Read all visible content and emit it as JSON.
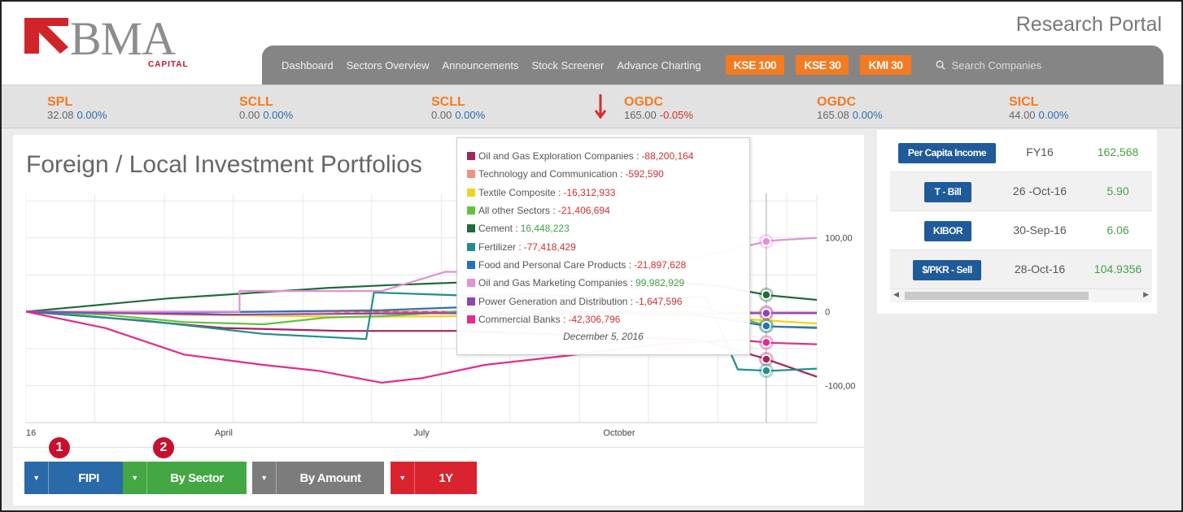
{
  "header": {
    "logo_text": "BMA",
    "logo_sub": "CAPITAL",
    "portal_title": "Research Portal",
    "nav": [
      "Dashboard",
      "Sectors Overview",
      "Announcements",
      "Stock Screener",
      "Advance Charting"
    ],
    "index_buttons": [
      "KSE 100",
      "KSE 30",
      "KMI 30"
    ],
    "search_placeholder": "Search Companies"
  },
  "ticker": [
    {
      "symbol": "SPL",
      "price": "32.08",
      "change": "0.00%"
    },
    {
      "symbol": "SCLL",
      "price": "0.00",
      "change": "0.00%"
    },
    {
      "symbol": "SCLL",
      "price": "0.00",
      "change": "0.00%"
    },
    {
      "symbol": "OGDC",
      "price": "165.00",
      "change": "-0.05%"
    },
    {
      "symbol": "OGDC",
      "price": "165.08",
      "change": "0.00%"
    },
    {
      "symbol": "SICL",
      "price": "44.00",
      "change": "0.00%"
    }
  ],
  "chart_panel": {
    "title": "Foreign / Local Investment Portfolios",
    "controls": [
      {
        "label": "FIPI",
        "color": "#2a6aa8"
      },
      {
        "label": "By Sector",
        "color": "#43a843"
      },
      {
        "label": "By Amount",
        "color": "#7c7c7c"
      },
      {
        "label": "1Y",
        "color": "#d9232e"
      }
    ],
    "step_badges": [
      "1",
      "2"
    ]
  },
  "tooltip": {
    "rows": [
      {
        "name": "Oil and Gas Exploration Companies",
        "value": "-88,200,164",
        "color": "#a5245d"
      },
      {
        "name": "Technology and Communication",
        "value": "-592,590",
        "color": "#f5907a"
      },
      {
        "name": "Textile Composite",
        "value": "-16,312,933",
        "color": "#f2d21d"
      },
      {
        "name": "All other Sectors",
        "value": "-21,406,694",
        "color": "#63c23c"
      },
      {
        "name": "Cement",
        "value": "16,448,223",
        "color": "#1f6b3a"
      },
      {
        "name": "Fertilizer",
        "value": "-77,418,429",
        "color": "#208f8a"
      },
      {
        "name": "Food and Personal Care Products",
        "value": "-21,897,628",
        "color": "#2a72b8"
      },
      {
        "name": "Oil and Gas Marketing Companies",
        "value": "99,982,929",
        "color": "#e191d6"
      },
      {
        "name": "Power Generation and Distribution",
        "value": "-1,647,596",
        "color": "#8a47b4"
      },
      {
        "name": "Commercial Banks",
        "value": "-42,306,796",
        "color": "#e42b8e"
      }
    ],
    "date": "December 5, 2016"
  },
  "chart_data": {
    "type": "line",
    "x_tick_labels": [
      "16",
      "April",
      "July",
      "October"
    ],
    "y_tick_labels": [
      "100,00",
      "0",
      "-100,00"
    ],
    "series": [
      {
        "name": "Oil and Gas Exploration Companies",
        "color": "#a5245d",
        "points": [
          [
            0,
            0
          ],
          [
            0.1,
            -8
          ],
          [
            0.25,
            -22
          ],
          [
            0.4,
            -26
          ],
          [
            0.55,
            -26
          ],
          [
            0.7,
            -32
          ],
          [
            0.85,
            -38
          ],
          [
            0.93,
            -62
          ],
          [
            1,
            -88
          ]
        ]
      },
      {
        "name": "Technology and Communication",
        "color": "#f5907a",
        "points": [
          [
            0,
            0
          ],
          [
            0.2,
            0
          ],
          [
            0.4,
            0
          ],
          [
            0.6,
            0
          ],
          [
            0.8,
            0
          ],
          [
            0.94,
            -1
          ],
          [
            1,
            -1
          ]
        ]
      },
      {
        "name": "Textile Composite",
        "color": "#f2d21d",
        "points": [
          [
            0,
            0
          ],
          [
            0.2,
            -4
          ],
          [
            0.4,
            -7
          ],
          [
            0.55,
            -6
          ],
          [
            0.7,
            -4
          ],
          [
            0.85,
            -6
          ],
          [
            0.94,
            -12
          ],
          [
            1,
            -16
          ]
        ]
      },
      {
        "name": "All other Sectors",
        "color": "#63c23c",
        "points": [
          [
            0,
            0
          ],
          [
            0.1,
            -4
          ],
          [
            0.2,
            -14
          ],
          [
            0.3,
            -17
          ],
          [
            0.38,
            -8
          ],
          [
            0.45,
            -6
          ],
          [
            0.6,
            4
          ],
          [
            0.75,
            8
          ],
          [
            0.85,
            8
          ],
          [
            0.94,
            -20
          ],
          [
            1,
            -21
          ]
        ]
      },
      {
        "name": "Cement",
        "color": "#1f6b3a",
        "points": [
          [
            0,
            0
          ],
          [
            0.08,
            8
          ],
          [
            0.18,
            18
          ],
          [
            0.28,
            25
          ],
          [
            0.38,
            32
          ],
          [
            0.46,
            36
          ],
          [
            0.56,
            40
          ],
          [
            0.68,
            45
          ],
          [
            0.8,
            42
          ],
          [
            0.88,
            34
          ],
          [
            0.94,
            22
          ],
          [
            1,
            16
          ]
        ]
      },
      {
        "name": "Fertilizer",
        "color": "#208f8a",
        "points": [
          [
            0,
            0
          ],
          [
            0.15,
            -12
          ],
          [
            0.3,
            -30
          ],
          [
            0.43,
            -37
          ],
          [
            0.44,
            26
          ],
          [
            0.55,
            22
          ],
          [
            0.65,
            24
          ],
          [
            0.75,
            16
          ],
          [
            0.86,
            20
          ],
          [
            0.9,
            -78
          ],
          [
            0.94,
            -80
          ],
          [
            1,
            -77
          ]
        ]
      },
      {
        "name": "Food and Personal Care Products",
        "color": "#2a72b8",
        "points": [
          [
            0,
            0
          ],
          [
            0.15,
            -2
          ],
          [
            0.3,
            0
          ],
          [
            0.45,
            2
          ],
          [
            0.55,
            6
          ],
          [
            0.7,
            0
          ],
          [
            0.85,
            -4
          ],
          [
            0.94,
            -20
          ],
          [
            1,
            -22
          ]
        ]
      },
      {
        "name": "Oil and Gas Marketing Companies",
        "color": "#e191d6",
        "points": [
          [
            0,
            0
          ],
          [
            0.27,
            0
          ],
          [
            0.27,
            28
          ],
          [
            0.45,
            28
          ],
          [
            0.53,
            54
          ],
          [
            0.68,
            52
          ],
          [
            0.8,
            62
          ],
          [
            0.9,
            86
          ],
          [
            0.94,
            96
          ],
          [
            1,
            100
          ]
        ]
      },
      {
        "name": "Power Generation and Distribution",
        "color": "#8a47b4",
        "points": [
          [
            0,
            0
          ],
          [
            0.25,
            -4
          ],
          [
            0.5,
            -2
          ],
          [
            0.75,
            -3
          ],
          [
            0.94,
            -2
          ],
          [
            1,
            -2
          ]
        ]
      },
      {
        "name": "Commercial Banks",
        "color": "#e42b8e",
        "points": [
          [
            0,
            0
          ],
          [
            0.1,
            -22
          ],
          [
            0.2,
            -58
          ],
          [
            0.3,
            -72
          ],
          [
            0.37,
            -80
          ],
          [
            0.45,
            -96
          ],
          [
            0.5,
            -90
          ],
          [
            0.58,
            -72
          ],
          [
            0.68,
            -60
          ],
          [
            0.8,
            -44
          ],
          [
            0.9,
            -38
          ],
          [
            0.94,
            -42
          ],
          [
            1,
            -44
          ]
        ]
      }
    ]
  },
  "right_panel": {
    "rows": [
      {
        "label": "Per Capita Income",
        "date": "FY16",
        "value": "162,568"
      },
      {
        "label": "T - Bill",
        "date": "26 -Oct-16",
        "value": "5.90"
      },
      {
        "label": "KIBOR",
        "date": "30-Sep-16",
        "value": "6.06"
      },
      {
        "label": "$/PKR - Sell",
        "date": "28-Oct-16",
        "value": "104.9356"
      }
    ]
  }
}
